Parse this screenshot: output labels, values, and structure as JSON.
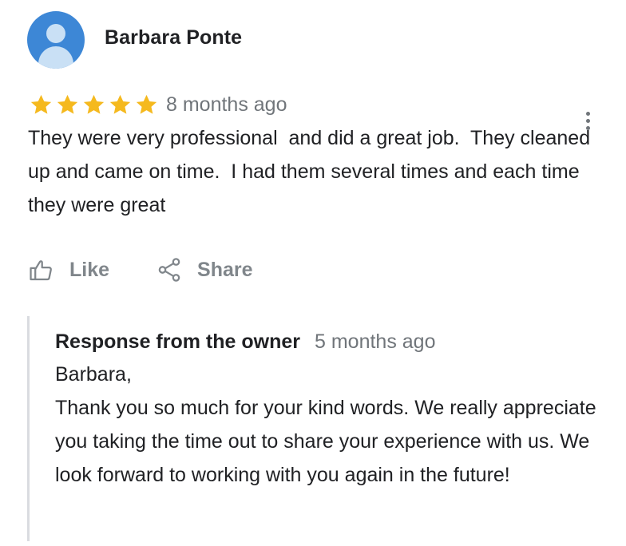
{
  "review": {
    "reviewer_name": "Barbara Ponte",
    "avatar_icon": "person-avatar-icon",
    "rating": 5,
    "rating_max": 5,
    "star_color": "#f5b91e",
    "time_ago": "8 months ago",
    "text": "They were very professional  and did a great job.  They cleaned up and came on time.  I had them several times and each time they were great",
    "more_icon": "vertical-ellipsis-icon"
  },
  "actions": {
    "like_label": "Like",
    "like_icon": "thumbs-up-icon",
    "share_label": "Share",
    "share_icon": "share-icon"
  },
  "owner_response": {
    "title": "Response from the owner",
    "time_ago": "5 months ago",
    "text": "Barbara,\nThank you so much for your kind words. We really appreciate you taking the time out to share your experience with us. We look forward to working with you again in the future!"
  },
  "colors": {
    "avatar_background": "#3d87d6",
    "secondary_text": "#70757a",
    "action_text": "#80868b",
    "response_border": "#dadce0"
  }
}
